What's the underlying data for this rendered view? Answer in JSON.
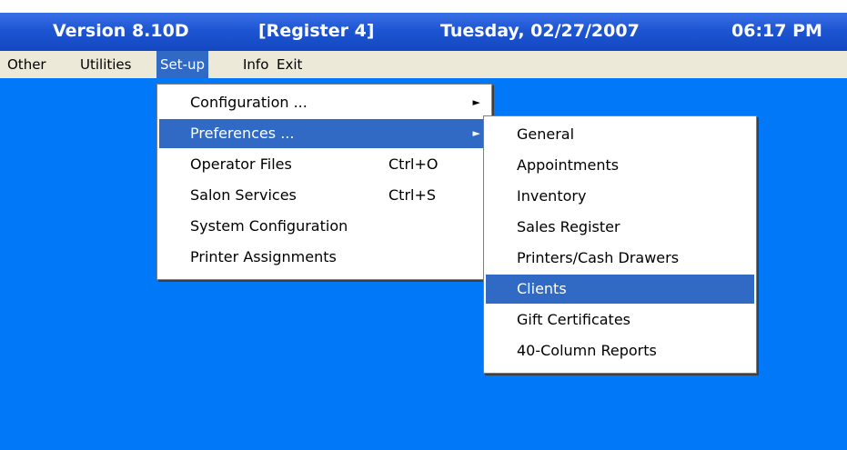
{
  "titlebar": {
    "version": "Version 8.10D",
    "register": "[Register 4]",
    "date": "Tuesday, 02/27/2007",
    "time": "06:17 PM"
  },
  "menubar": {
    "items": [
      {
        "label": "Other"
      },
      {
        "label": "Utilities"
      },
      {
        "label": "Set-up",
        "active": true
      },
      {
        "label": "Info"
      },
      {
        "label": "Exit"
      }
    ]
  },
  "setup_menu": {
    "items": [
      {
        "label": "Configuration ...",
        "submenu": true,
        "arrow": "►"
      },
      {
        "label": "Preferences ...",
        "submenu": true,
        "arrow": "►",
        "highlighted": true
      },
      {
        "label": "Operator Files",
        "shortcut": "Ctrl+O"
      },
      {
        "label": "Salon Services",
        "shortcut": "Ctrl+S"
      },
      {
        "label": "System Configuration"
      },
      {
        "label": "Printer Assignments"
      }
    ]
  },
  "preferences_submenu": {
    "items": [
      {
        "label": "General"
      },
      {
        "label": "Appointments"
      },
      {
        "label": "Inventory"
      },
      {
        "label": "Sales Register"
      },
      {
        "label": "Printers/Cash Drawers"
      },
      {
        "label": "Clients",
        "highlighted": true
      },
      {
        "label": "Gift Certificates"
      },
      {
        "label": "40-Column Reports"
      }
    ]
  },
  "colors": {
    "titlebar": "#1e55d2",
    "desktop": "#0078f8",
    "menubar": "#ece9d8",
    "highlight": "#316ac5"
  }
}
